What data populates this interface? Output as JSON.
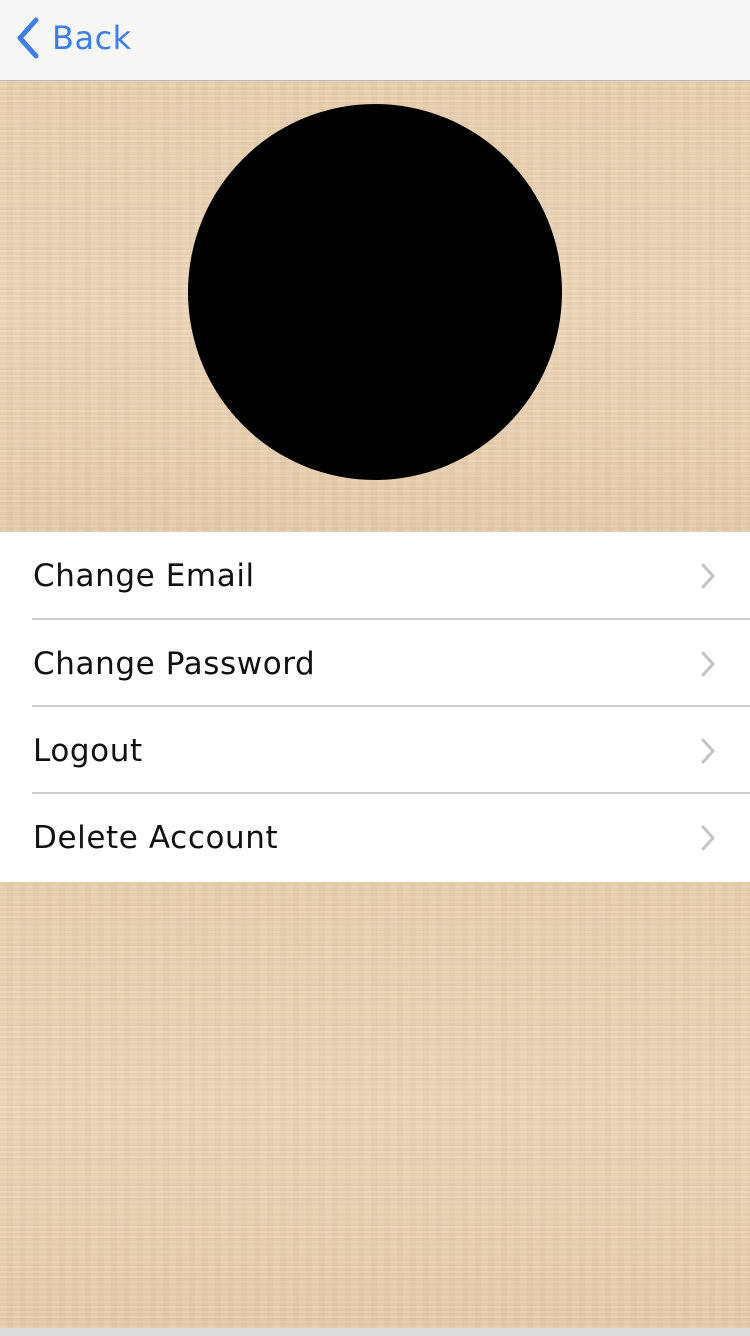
{
  "nav": {
    "back_label": "Back",
    "back_icon": "chevron-left-icon",
    "accent_color": "#3d7fe6"
  },
  "profile": {
    "avatar_color": "#000000"
  },
  "menu": {
    "items": [
      {
        "label": "Change Email",
        "icon": "chevron-right-icon"
      },
      {
        "label": "Change Password",
        "icon": "chevron-right-icon"
      },
      {
        "label": "Logout",
        "icon": "chevron-right-icon"
      },
      {
        "label": "Delete Account",
        "icon": "chevron-right-icon"
      }
    ]
  },
  "theme": {
    "background": "wood-texture",
    "background_color": "#ead2b3",
    "chevron_color": "#c4c4c4"
  }
}
